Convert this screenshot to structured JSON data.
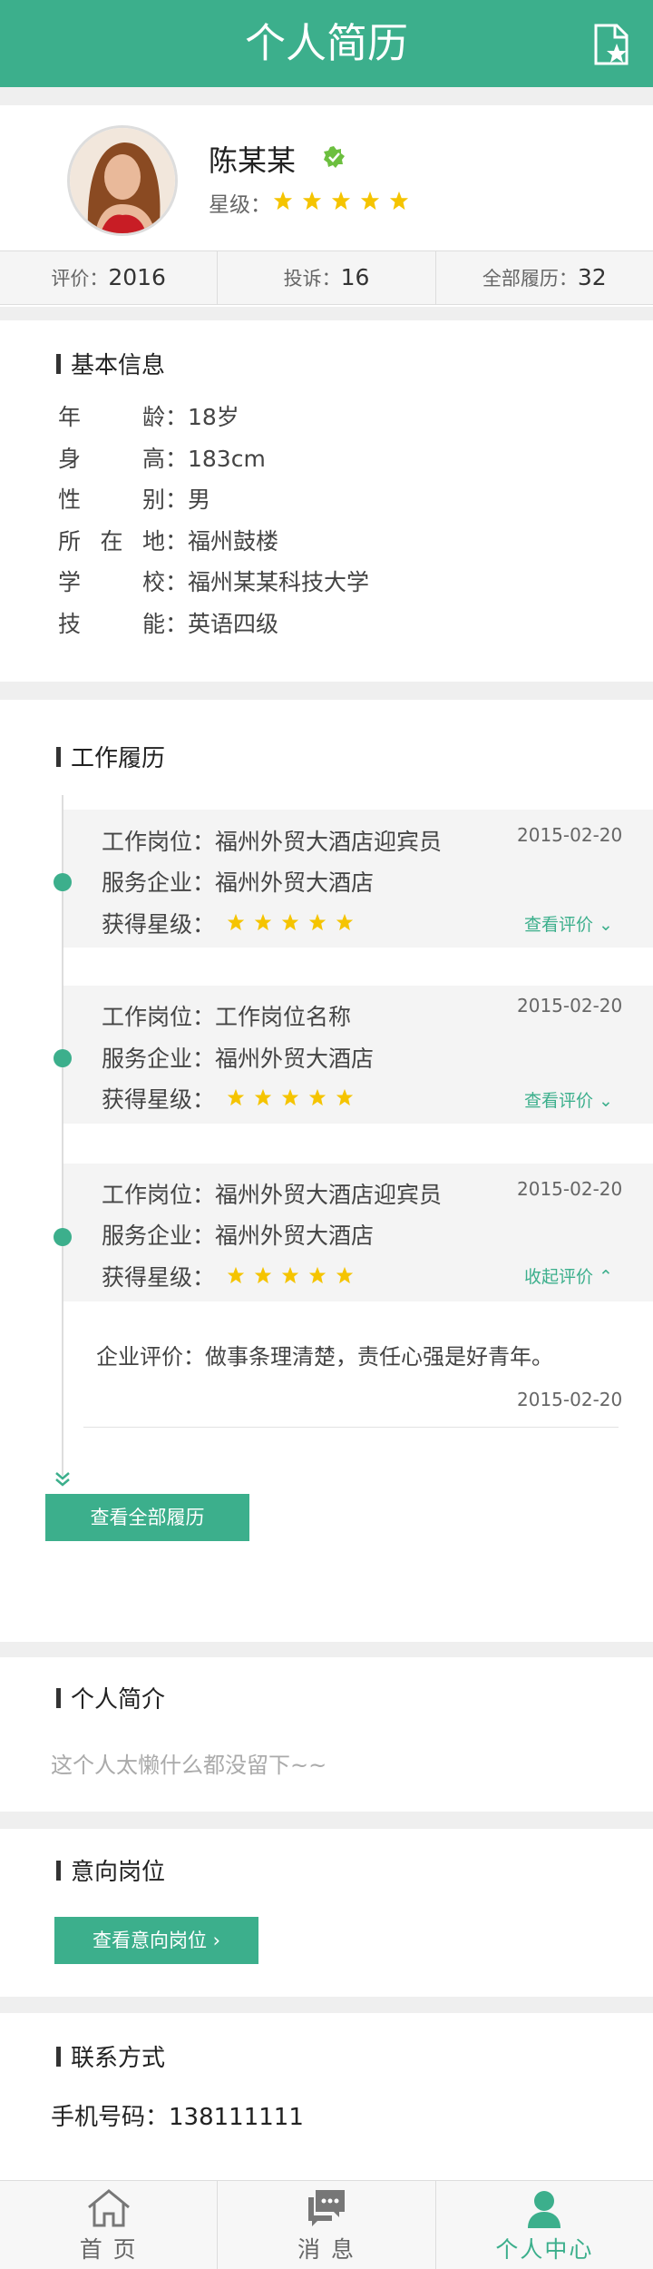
{
  "header": {
    "title": "个人简历"
  },
  "profile": {
    "name": "陈某某",
    "level_label": "星级：",
    "stars": 5
  },
  "stats": [
    {
      "label": "评价：",
      "value": "2016"
    },
    {
      "label": "投诉：",
      "value": "16"
    },
    {
      "label": "全部履历：",
      "value": "32"
    }
  ],
  "basic": {
    "title": "基本信息",
    "rows": [
      {
        "key": "年龄",
        "value": "：18岁"
      },
      {
        "key": "身高",
        "value": "：183cm"
      },
      {
        "key": "性别",
        "value": "：男"
      },
      {
        "key": "所在地",
        "value": "：福州鼓楼"
      },
      {
        "key": "学校",
        "value": "：福州某某科技大学"
      },
      {
        "key": "技能",
        "value": "：英语四级"
      }
    ]
  },
  "work": {
    "title": "工作履历",
    "jobs": [
      {
        "position": "工作岗位：福州外贸大酒店迎宾员",
        "company": "服务企业：福州外贸大酒店",
        "rating_label": "获得星级：",
        "date": "2015-02-20",
        "link": "查看评价 ⌄"
      },
      {
        "position": "工作岗位：工作岗位名称",
        "company": "服务企业：福州外贸大酒店",
        "rating_label": "获得星级：",
        "date": "2015-02-20",
        "link": "查看评价 ⌄"
      },
      {
        "position": "工作岗位：福州外贸大酒店迎宾员",
        "company": "服务企业：福州外贸大酒店",
        "rating_label": "获得星级：",
        "date": "2015-02-20",
        "link": "收起评价 ⌃"
      }
    ],
    "review_text": "企业评价：做事条理清楚，责任心强是好青年。",
    "review_date": "2015-02-20",
    "all_button": "查看全部履历"
  },
  "intro": {
    "title": "个人简介",
    "text": "这个人太懒什么都没留下~~"
  },
  "intent": {
    "title": "意向岗位",
    "button": "查看意向岗位 ›"
  },
  "contact": {
    "title": "联系方式",
    "phone": "手机号码：138111111"
  },
  "tabs": [
    {
      "label": "首 页",
      "icon": "home-icon"
    },
    {
      "label": "消 息",
      "icon": "message-icon"
    },
    {
      "label": "个人中心",
      "icon": "person-icon"
    }
  ],
  "colors": {
    "accent": "#3caf8c",
    "star": "#f5c400"
  }
}
